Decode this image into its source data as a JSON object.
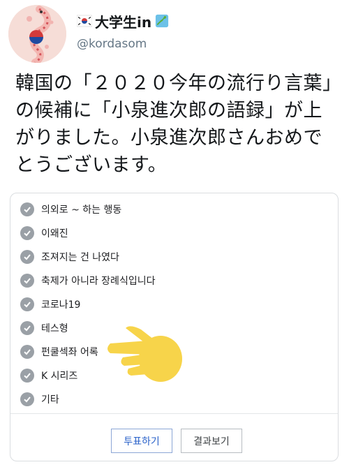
{
  "header": {
    "display_name": "大学生in",
    "handle": "@kordasom",
    "name_emoji_left": "korea-flag-icon",
    "name_emoji_right": "japan-map-icon"
  },
  "tweet": {
    "text": "韓国の「２０２０今年の流行り言葉」の候補に「小泉進次郎の語録」が上がりました。小泉進次郎さんおめでとうございます。"
  },
  "poll": {
    "options": [
      {
        "label": "의외로 ~ 하는 행동"
      },
      {
        "label": "이왜진"
      },
      {
        "label": "조져지는 건 나였다"
      },
      {
        "label": "축제가 아니라 장례식입니다"
      },
      {
        "label": "코로나19"
      },
      {
        "label": "테스형"
      },
      {
        "label": "펀쿨섹좌 어록"
      },
      {
        "label": "K 시리즈"
      },
      {
        "label": "기타"
      }
    ],
    "vote_button": "투표하기",
    "results_button": "결과보기",
    "highlighted_option_index": 6
  },
  "colors": {
    "check_gray": "#9aa0a6",
    "pointer_yellow": "#f7d44a",
    "vote_blue": "#2a62c9"
  }
}
